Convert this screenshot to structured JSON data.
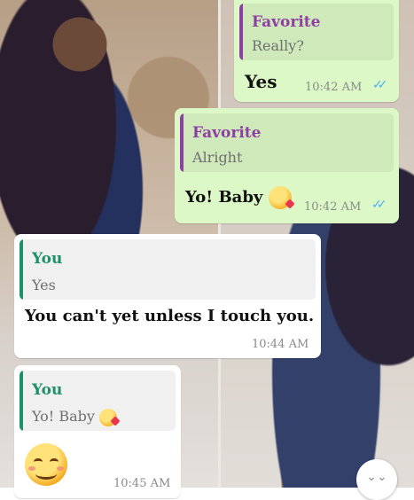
{
  "messages": [
    {
      "quote": {
        "author": "Favorite",
        "text": "Really?"
      },
      "text": "Yes",
      "time": "10:42 AM",
      "ticks": "✓✓"
    },
    {
      "quote": {
        "author": "Favorite",
        "text": "Alright"
      },
      "text": "Yo! Baby",
      "time": "10:42 AM",
      "ticks": "✓✓"
    },
    {
      "quote": {
        "author": "You",
        "text": "Yes"
      },
      "text": "You can't yet unless I touch you.",
      "time": "10:44 AM"
    },
    {
      "quote": {
        "author": "You",
        "text": "Yo! Baby"
      },
      "time": "10:45 AM"
    }
  ],
  "colors": {
    "outgoing_bubble": "#dcf8c6",
    "incoming_bubble": "#ffffff",
    "favorite_accent": "#8e3fa3",
    "you_accent": "#1f8f6a",
    "read_ticks": "#4fb3f6"
  },
  "icons": {
    "kiss_emoji": "face-blowing-kiss",
    "smile_emoji": "smiling-face",
    "scroll_down": "double-chevron-down-icon"
  },
  "scroll_button": {
    "glyph": "⌄⌄"
  }
}
